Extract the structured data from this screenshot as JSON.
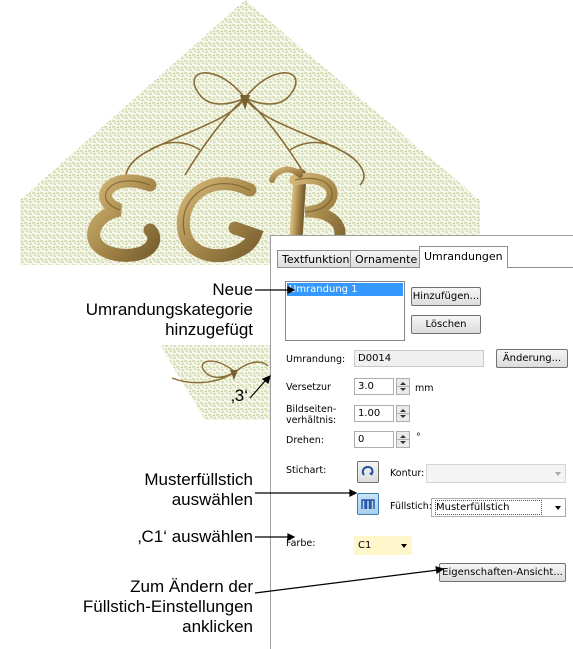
{
  "tabs": [
    {
      "label": "Textfunktion"
    },
    {
      "label": "Ornamente"
    },
    {
      "label": "Umrandungen"
    }
  ],
  "border_list": {
    "items": [
      "Umrandung 1"
    ]
  },
  "buttons": {
    "add": "Hinzufügen...",
    "delete": "Löschen",
    "change": "Änderung...",
    "properties": "Eigenschaften-Ansicht..."
  },
  "fields": {
    "border_label": "Umrandung:",
    "border_value": "D0014",
    "offset_label": "Versetzur",
    "offset_value": "3.0",
    "offset_unit": "mm",
    "aspect_label_1": "Bildseiten-",
    "aspect_label_2": "verhältnis:",
    "aspect_value": "1.00",
    "rotate_label": "Drehen:",
    "rotate_value": "0",
    "rotate_unit": "°",
    "stitch_label": "Stichart:",
    "outline_label": "Kontur:",
    "outline_value": "",
    "fill_label": "Füllstich:",
    "fill_value": "Musterfüllstich",
    "color_label": "Farbe:",
    "color_value": "C1"
  },
  "callouts": {
    "new_border_1": "Neue",
    "new_border_2": "Umrandungskategorie",
    "new_border_3": "hinzugefügt",
    "offset_value": "‚3‘",
    "pattern_fill_1": "Musterfüllstich",
    "pattern_fill_2": "auswählen",
    "c1_select": "‚C1‘ auswählen",
    "change_fill_1": "Zum Ändern der",
    "change_fill_2": "Füllstich-Einstellungen",
    "change_fill_3": "anklicken"
  },
  "colors": {
    "thread_gold": "#a88a4c",
    "thread_dark": "#6e5528",
    "fill_green": "#b9c98a",
    "selection_blue": "#3399ff",
    "color_swatch": "#fff6cc"
  },
  "icons": {
    "outline_stitch": "contour-icon",
    "fill_stitch": "fill-stitch-icon"
  }
}
